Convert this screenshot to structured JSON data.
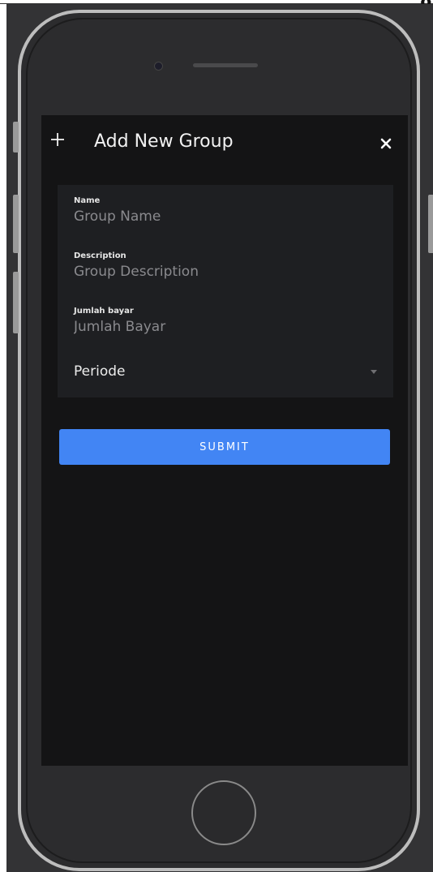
{
  "top_fragment": "g",
  "dialog": {
    "title": "Add New Group",
    "plus_icon": "plus-icon",
    "close_icon": "close-icon"
  },
  "form": {
    "name": {
      "label": "Name",
      "placeholder": "Group Name",
      "value": ""
    },
    "description": {
      "label": "Description",
      "placeholder": "Group Description",
      "value": ""
    },
    "amount": {
      "label": "Jumlah bayar",
      "placeholder": "Jumlah Bayar",
      "value": ""
    },
    "period": {
      "label": "Periode",
      "icon": "caret-down-icon"
    }
  },
  "submit_label": "SUBMIT",
  "colors": {
    "accent": "#4285f4",
    "screen_bg": "#141415",
    "card_bg": "#1e1f22",
    "device_bg": "#333335",
    "frame": "#bdbdbd"
  }
}
